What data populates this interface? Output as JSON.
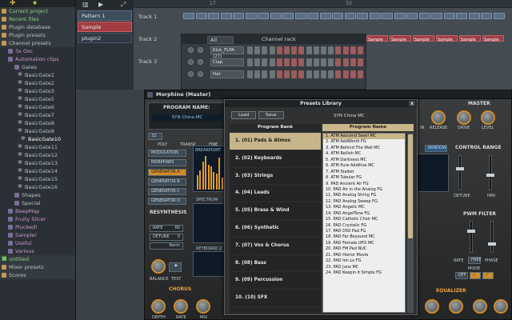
{
  "browser": {
    "items": [
      {
        "label": "Current project",
        "kind": "folder",
        "icon": "folder-icon"
      },
      {
        "label": "Recent files",
        "kind": "folder",
        "icon": "folder-icon"
      },
      {
        "label": "Plugin database",
        "kind": "folder",
        "icon": "folder-icon"
      },
      {
        "label": "Plugin presets",
        "kind": "folder",
        "icon": "folder-icon"
      },
      {
        "label": "Channel presets",
        "kind": "folder",
        "icon": "folder-icon"
      },
      {
        "label": "3x Osc",
        "kind": "sub",
        "icon": "folder-icon"
      },
      {
        "label": "Automation clips",
        "kind": "sub",
        "icon": "folder-icon"
      },
      {
        "label": "Gates",
        "kind": "sub2",
        "icon": "folder-icon"
      },
      {
        "label": "BasicGate1",
        "kind": "file",
        "icon": "gear-icon"
      },
      {
        "label": "BasicGate2",
        "kind": "file",
        "icon": "gear-icon"
      },
      {
        "label": "BasicGate3",
        "kind": "file",
        "icon": "gear-icon"
      },
      {
        "label": "BasicGate5",
        "kind": "file",
        "icon": "gear-icon"
      },
      {
        "label": "BasicGate6",
        "kind": "file",
        "icon": "gear-icon"
      },
      {
        "label": "BasicGate7",
        "kind": "file",
        "icon": "gear-icon"
      },
      {
        "label": "BasicGate8",
        "kind": "file",
        "icon": "gear-icon"
      },
      {
        "label": "BasicGate9",
        "kind": "file",
        "icon": "gear-icon"
      },
      {
        "label": "BasicGate10",
        "kind": "file-sel",
        "icon": "gear-icon"
      },
      {
        "label": "BasicGate11",
        "kind": "file",
        "icon": "gear-icon"
      },
      {
        "label": "BasicGate12",
        "kind": "file",
        "icon": "gear-icon"
      },
      {
        "label": "BasicGate13",
        "kind": "file",
        "icon": "gear-icon"
      },
      {
        "label": "BasicGate14",
        "kind": "file",
        "icon": "gear-icon"
      },
      {
        "label": "BasicGate15",
        "kind": "file",
        "icon": "gear-icon"
      },
      {
        "label": "BasicGate16",
        "kind": "file",
        "icon": "gear-icon"
      },
      {
        "label": "Shapes",
        "kind": "sub2",
        "icon": "folder-icon"
      },
      {
        "label": "Special",
        "kind": "sub2",
        "icon": "folder-icon"
      },
      {
        "label": "BeepMap",
        "kind": "sub",
        "icon": "folder-icon"
      },
      {
        "label": "Fruity Slicer",
        "kind": "sub",
        "icon": "folder-icon"
      },
      {
        "label": "Plucked!",
        "kind": "sub",
        "icon": "folder-icon"
      },
      {
        "label": "Sampler",
        "kind": "sub",
        "icon": "folder-icon"
      },
      {
        "label": "Useful",
        "kind": "sub",
        "icon": "folder-icon"
      },
      {
        "label": "Various",
        "kind": "sub",
        "icon": "folder-icon"
      },
      {
        "label": "untitled",
        "kind": "green",
        "icon": "file-icon"
      },
      {
        "label": "Mixer presets",
        "kind": "folder",
        "icon": "folder-icon"
      },
      {
        "label": "Scores",
        "kind": "folder",
        "icon": "folder-icon"
      }
    ]
  },
  "patterns": {
    "items": [
      {
        "label": "Pattern 1",
        "style": "blue"
      },
      {
        "label": "Sample",
        "style": "red"
      },
      {
        "label": "plugin2",
        "style": "dark"
      }
    ]
  },
  "playlist": {
    "ruler": [
      "17",
      "33"
    ],
    "tracks": [
      "Track 1",
      "Track 2",
      "Track 3"
    ],
    "clip_label": "Sample"
  },
  "channel_rack": {
    "filter": "All",
    "title": "Channel rack",
    "channels": [
      {
        "name": "Kick_FLPA (27)"
      },
      {
        "name": "Clap"
      },
      {
        "name": "Hat"
      }
    ]
  },
  "morphine": {
    "window_title": "Morphine (Master)",
    "program_name_label": "PROGRAM NAME:",
    "program_name": "SYN China MC",
    "poly_label": "POLY",
    "transp_label": "TRANSP",
    "fine_label": "FINE",
    "poly_value": "32",
    "tabs": [
      "MODULATION",
      "MORPHNES",
      "GENERATOR A",
      "GENERATOR B",
      "GENERATOR C",
      "GENERATOR D"
    ],
    "resynthesis_label": "RESYNTHESIS",
    "rate_label": "RATE",
    "rate_value": "60",
    "detune_label": "DETUNE",
    "detune_value": "0",
    "norm_label": "Norm",
    "balance_label": "BALANCE",
    "test_label": "TEST",
    "chorus_label": "CHORUS",
    "depth_label": "DEPTH",
    "mix_label": "MIX",
    "breakpoint_label": "BREAKPOINT",
    "spectrum_label": "SPECTRUM",
    "keyboard_label": "KEYBOARD 2",
    "master_label": "MASTER",
    "release_label": "RELEASE",
    "drive_label": "DRIVE",
    "level_label": "LEVEL",
    "control_range_label": "CONTROL RANGE",
    "pwm_filter_label": "PWM FILTER",
    "detune2_label": "DETUNE",
    "pan_label": "PAN",
    "window_label": "WINDOW",
    "mode_label": "MODE",
    "phase_label": "PHASE",
    "free_label": "FREE",
    "off_label": "OFF",
    "equalizer_label": "EQUALIZER",
    "breakpoint_levels": [
      0.4,
      0.55,
      0.8,
      0.95,
      0.7,
      0.65,
      0.5,
      0.45,
      0.9,
      0.35
    ]
  },
  "presets_dialog": {
    "title": "Presets Library",
    "close_label": "x",
    "load_label": "Load",
    "save_label": "Save",
    "current_program": "SYN China MC",
    "bank_header": "Program Bank",
    "program_header": "Program Name",
    "banks": [
      "1. (01) Pads & Atmos",
      "2. (02) Keyboards",
      "3. (03) Strings",
      "4. (04) Leads",
      "5. (05) Brass & Wind",
      "6. (06) Synthetic",
      "7. (07) Vox & Chorus",
      "8. (08) Bass",
      "9. (09) Percussion",
      "10. (10) SFX"
    ],
    "selected_bank": 0,
    "programs": [
      "1. ATM Asscend Swell MC",
      "2. ATM AddWorld FG",
      "3. ATM Behind The Wall MC",
      "4. ATM Bellish MC",
      "5. ATM Darkness MC",
      "6. ATM Pure Additive MC",
      "7. ATM Stalker",
      "8. ATM Tubular FG",
      "9. PAD Ancient Air FG",
      "10. PAD Air in the Analog FG",
      "11. PAD Analog String FG",
      "12. PAD Analog Sweep FG",
      "13. PAD Angelic MC",
      "14. PAD AngelTone FG",
      "15. PAD Catholic Choir MC",
      "16. PAD Crystalic FG",
      "17. PAD D50 Pad FG",
      "18. PAD Far Beyound MC",
      "19. PAD Female UFO MC",
      "20. PAD FM Pad NUC",
      "21. PAD Horror Movie",
      "22. PAD Ion Lo FG",
      "23. PAD Juno MC",
      "24. PAD Keepin it Simple FG"
    ],
    "selected_program": 0
  },
  "colors": {
    "accent": "#d08b2a",
    "selection": "#c9b68a",
    "clip_blue": "#5a6d87",
    "clip_red": "#9e3d45"
  }
}
